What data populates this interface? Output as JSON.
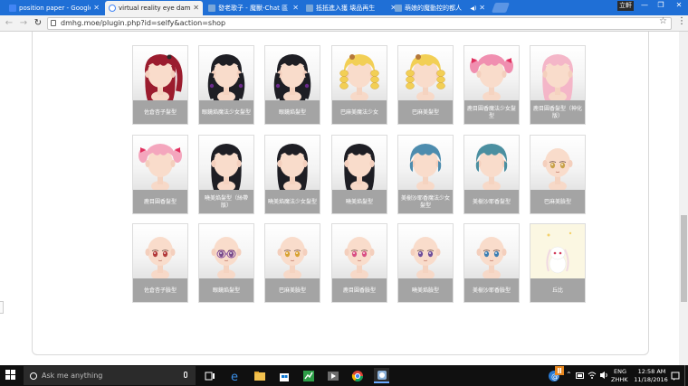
{
  "tabs": [
    {
      "title": "position paper - Google",
      "favicon_color": "#4285f4",
      "active": false
    },
    {
      "title": "virtual reality eye damag",
      "favicon_color": "#ffffff",
      "active": true
    },
    {
      "title": "發老歌子 - 魔獸-Chat 區",
      "favicon_color": "#7aa7d9",
      "active": false
    },
    {
      "title": "抵抵進入獲 壊品再生",
      "favicon_color": "#7aa7d9",
      "active": false
    },
    {
      "title": "萌娘的魔動控的都人",
      "favicon_color": "#7aa7d9",
      "active": false
    }
  ],
  "window": {
    "profile_label": "立軒",
    "minimize": "—",
    "restore": "❐",
    "close": "✕"
  },
  "toolbar": {
    "back": "←",
    "forward": "→",
    "reload": "↻",
    "url": "dmhg.moe/plugin.php?id=selfy&action=shop",
    "star": "☆",
    "menu": "⋮"
  },
  "shop": {
    "rows": [
      [
        {
          "label": "佐倉杏子髮型",
          "kind": "hair",
          "hair": "#9b1c2e",
          "style": "ponytail"
        },
        {
          "label": "眼鏡焰魔法少女髮型",
          "kind": "hair",
          "hair": "#1e1e24",
          "style": "braids"
        },
        {
          "label": "眼鏡焰髮型",
          "kind": "hair",
          "hair": "#1e1e24",
          "style": "braids"
        },
        {
          "label": "巴麻美魔法少女",
          "kind": "hair",
          "hair": "#f2cf55",
          "style": "drills"
        },
        {
          "label": "巴麻美髮型",
          "kind": "hair",
          "hair": "#f2cf55",
          "style": "drills"
        },
        {
          "label": "鹿目圓香魔法少女髮型",
          "kind": "hair",
          "hair": "#f08fb0",
          "style": "twintail"
        },
        {
          "label": "鹿目圓香髮型（神化版）",
          "kind": "hair",
          "hair": "#f4b6c8",
          "style": "long"
        }
      ],
      [
        {
          "label": "鹿目圓香髮型",
          "kind": "hair",
          "hair": "#f4a6bd",
          "style": "twintail"
        },
        {
          "label": "曉美焰髮型（絲帶版）",
          "kind": "hair",
          "hair": "#1e1e24",
          "style": "long"
        },
        {
          "label": "曉美焰魔法少女髮型",
          "kind": "hair",
          "hair": "#1e1e24",
          "style": "long"
        },
        {
          "label": "曉美焰髮型",
          "kind": "hair",
          "hair": "#1e1e24",
          "style": "long"
        },
        {
          "label": "美樹沙耶香魔法少女髮型",
          "kind": "hair",
          "hair": "#4d8cae",
          "style": "short"
        },
        {
          "label": "美樹沙耶香髮型",
          "kind": "hair",
          "hair": "#4b8fa0",
          "style": "short"
        },
        {
          "label": "巴麻美臉型",
          "kind": "face",
          "eye": "#c9a24a"
        }
      ],
      [
        {
          "label": "佐倉杏子臉型",
          "kind": "face",
          "eye": "#b33a3a"
        },
        {
          "label": "眼鏡焰髮型",
          "kind": "face",
          "eye": "#7a4d8c",
          "glasses": true
        },
        {
          "label": "巴麻美臉型",
          "kind": "face",
          "eye": "#d9a233"
        },
        {
          "label": "鹿目圓香臉型",
          "kind": "face",
          "eye": "#d94f83"
        },
        {
          "label": "曉美焰臉型",
          "kind": "face",
          "eye": "#6f4f9a"
        },
        {
          "label": "美樹沙耶香臉型",
          "kind": "face",
          "eye": "#3d7fb3"
        },
        {
          "label": "丘比",
          "kind": "kyubey"
        }
      ]
    ]
  },
  "taskbar": {
    "search_placeholder": "Ask me anything",
    "lang_line1": "ENG",
    "lang_line2": "ZHHK",
    "time": "12:58 AM",
    "date": "11/18/2016"
  }
}
